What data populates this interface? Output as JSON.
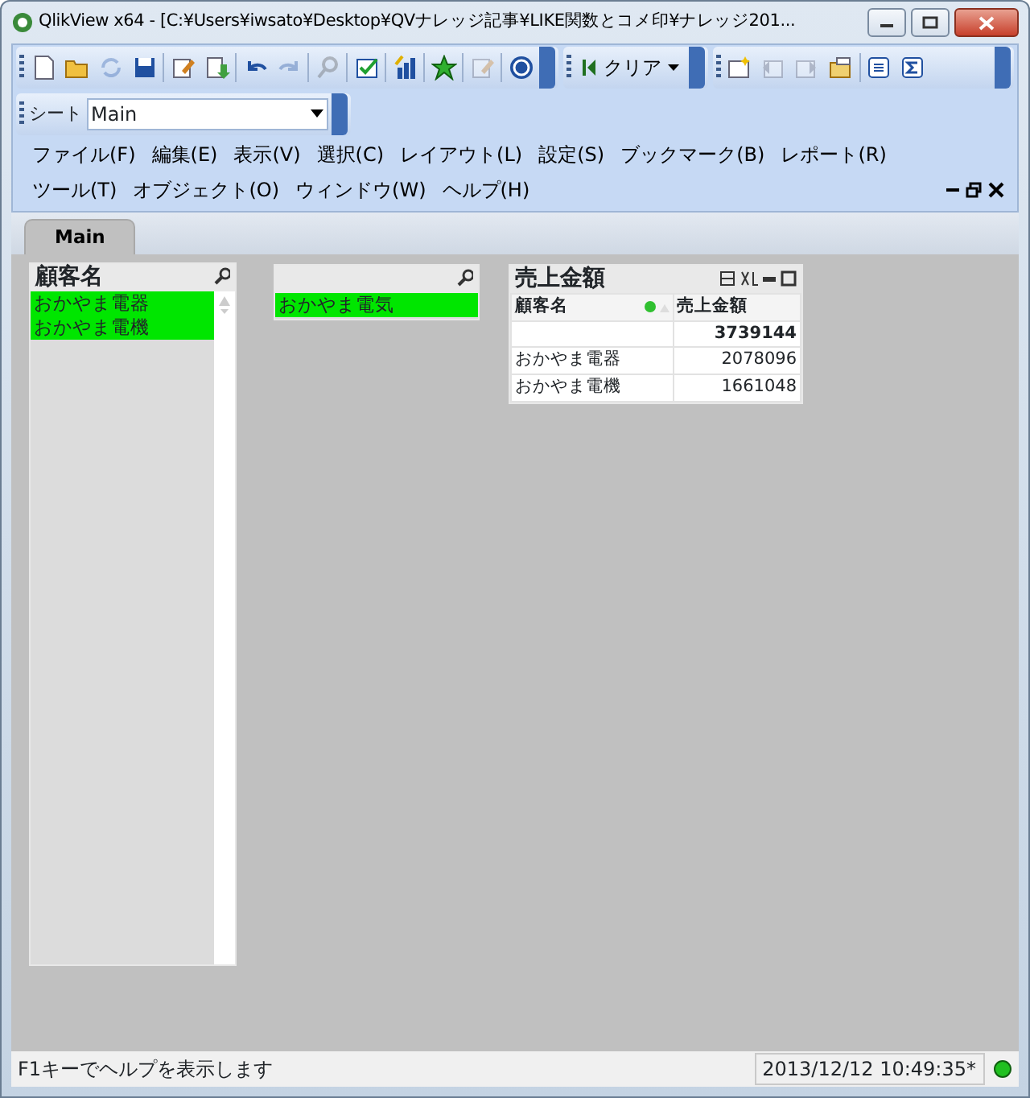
{
  "window": {
    "title": "QlikView x64 - [C:¥Users¥iwsato¥Desktop¥QVナレッジ記事¥LIKE関数とコメ印¥ナレッジ201..."
  },
  "toolbar": [
    {
      "kind": "new",
      "disabled": false
    },
    {
      "kind": "open",
      "disabled": false
    },
    {
      "kind": "reload",
      "disabled": true
    },
    {
      "kind": "save",
      "disabled": false
    },
    {
      "kind": "sep"
    },
    {
      "kind": "edit",
      "disabled": false
    },
    {
      "kind": "import",
      "disabled": false
    },
    {
      "kind": "sep"
    },
    {
      "kind": "undo",
      "disabled": false
    },
    {
      "kind": "redo",
      "disabled": true
    },
    {
      "kind": "sep"
    },
    {
      "kind": "search",
      "disabled": true
    },
    {
      "kind": "sep"
    },
    {
      "kind": "check",
      "disabled": false
    },
    {
      "kind": "sep"
    },
    {
      "kind": "chart",
      "disabled": false
    },
    {
      "kind": "sep"
    },
    {
      "kind": "star",
      "disabled": false
    },
    {
      "kind": "sep"
    },
    {
      "kind": "edit",
      "disabled": true
    },
    {
      "kind": "sep"
    },
    {
      "kind": "help",
      "disabled": false
    }
  ],
  "clear_button": {
    "label": "クリア"
  },
  "toolbar2": [
    {
      "kind": "sheet-new",
      "disabled": false
    },
    {
      "kind": "back",
      "disabled": true
    },
    {
      "kind": "forward",
      "disabled": true
    },
    {
      "kind": "folder",
      "disabled": false
    },
    {
      "kind": "sep"
    },
    {
      "kind": "list",
      "disabled": false
    },
    {
      "kind": "sum",
      "disabled": false
    }
  ],
  "sheet_selector": {
    "label": "シート",
    "value": "Main"
  },
  "menu": [
    [
      "ファイル(F)",
      "編集(E)",
      "表示(V)",
      "選択(C)",
      "レイアウト(L)",
      "設定(S)",
      "ブックマーク(B)",
      "レポート(R)"
    ],
    [
      "ツール(T)",
      "オブジェクト(O)",
      "ウィンドウ(W)",
      "ヘルプ(H)"
    ]
  ],
  "tabs": [
    {
      "label": "Main",
      "selected": true
    }
  ],
  "listboxes": [
    {
      "title": "顧客名",
      "items": [
        {
          "label": "おかやま電器",
          "selected": true
        },
        {
          "label": "おかやま電機",
          "selected": true
        }
      ],
      "scrollbar": true
    },
    {
      "items": [
        {
          "label": "おかやま電気",
          "selected": true
        }
      ],
      "scrollbar": false
    }
  ],
  "table": {
    "title": "売上金額",
    "columns": [
      "顧客名",
      "売上金額"
    ],
    "total": "3739144",
    "rows": [
      [
        "おかやま電器",
        "2078096"
      ],
      [
        "おかやま電機",
        "1661048"
      ]
    ]
  },
  "status_bar": {
    "message": "F1キーでヘルプを表示します",
    "timestamp": "2013/12/12 10:49:35*"
  }
}
